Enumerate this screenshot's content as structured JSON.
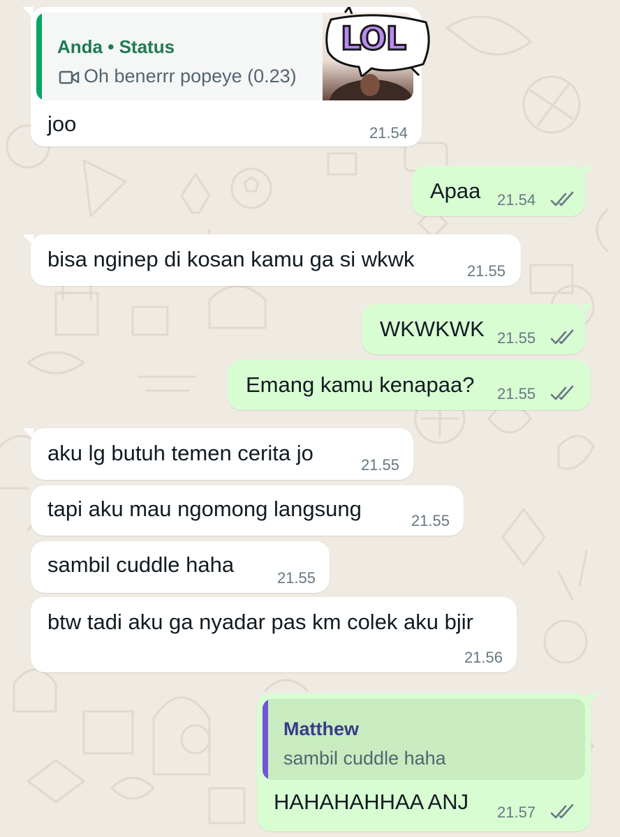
{
  "messages": [
    {
      "direction": "incoming",
      "text": "joo",
      "time": "21.54",
      "quote": {
        "author": "Anda",
        "separator": "•",
        "source": "Status",
        "media_icon": "video-icon",
        "text": "Oh benerrr popeye (0.23)",
        "sticker_text": "LOL"
      }
    },
    {
      "direction": "outgoing",
      "text": "Apaa",
      "time": "21.54",
      "status": "read"
    },
    {
      "direction": "incoming",
      "text": "bisa nginep di kosan kamu ga si wkwk",
      "time": "21.55"
    },
    {
      "direction": "outgoing",
      "text": "WKWKWK",
      "time": "21.55",
      "status": "read"
    },
    {
      "direction": "outgoing",
      "text": "Emang kamu kenapaa?",
      "time": "21.55",
      "status": "read"
    },
    {
      "direction": "incoming",
      "text": "aku lg butuh temen cerita jo",
      "time": "21.55"
    },
    {
      "direction": "incoming",
      "text": "tapi aku mau ngomong langsung",
      "time": "21.55"
    },
    {
      "direction": "incoming",
      "text": "sambil cuddle haha",
      "time": "21.55"
    },
    {
      "direction": "incoming",
      "text": "btw tadi aku ga nyadar pas km colek aku bjir",
      "time": "21.56"
    },
    {
      "direction": "outgoing",
      "text": "HAHAHAHHAA ANJ",
      "time": "21.57",
      "status": "read",
      "quote": {
        "author": "Matthew",
        "text": "sambil cuddle haha"
      }
    }
  ],
  "colors": {
    "wallpaper": "#efeae2",
    "incoming_bubble": "#ffffff",
    "outgoing_bubble": "#d9fdd3",
    "read_ticks": "#667781",
    "status_quote_bar": "#06a660",
    "message_quote_bar": "#7354d8"
  }
}
